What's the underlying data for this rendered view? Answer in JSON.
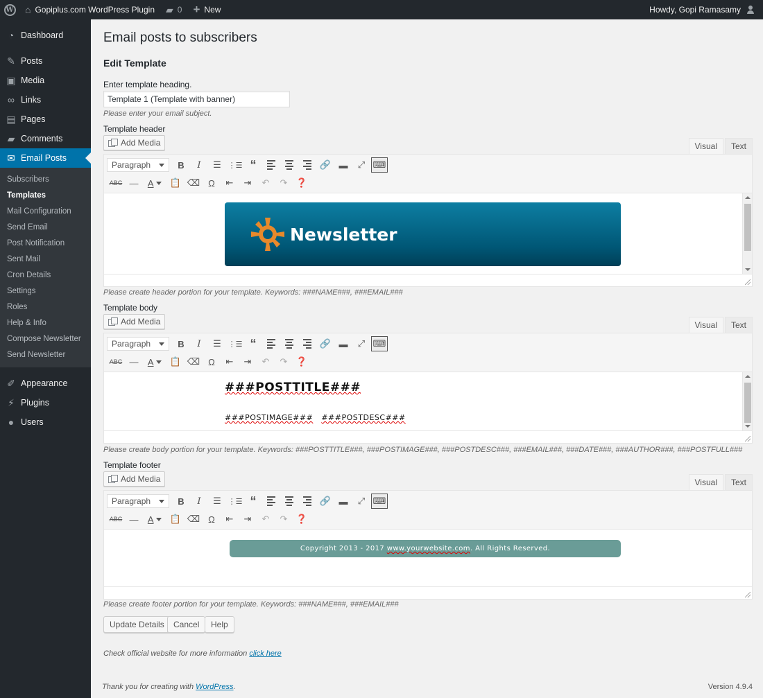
{
  "adminbar": {
    "site_name": "Gopiplus.com WordPress Plugin",
    "comments_count": "0",
    "new_label": "New",
    "greeting": "Howdy, Gopi Ramasamy"
  },
  "menu": {
    "dashboard": "Dashboard",
    "posts": "Posts",
    "media": "Media",
    "links": "Links",
    "pages": "Pages",
    "comments": "Comments",
    "email_posts": "Email Posts",
    "sub": [
      "Subscribers",
      "Templates",
      "Mail Configuration",
      "Send Email",
      "Post Notification",
      "Sent Mail",
      "Cron Details",
      "Settings",
      "Roles",
      "Help & Info",
      "Compose Newsletter",
      "Send Newsletter"
    ],
    "appearance": "Appearance",
    "plugins": "Plugins",
    "users": "Users"
  },
  "page": {
    "title": "Email posts to subscribers",
    "subtitle": "Edit Template",
    "heading_label": "Enter template heading.",
    "heading_value": "Template 1 (Template with banner)",
    "heading_desc": "Please enter your email subject.",
    "header_label": "Template header",
    "header_desc": "Please create header portion for your template. Keywords: ###NAME###, ###EMAIL###",
    "body_label": "Template body",
    "body_desc": "Please create body portion for your template. Keywords: ###POSTTITLE###, ###POSTIMAGE###, ###POSTDESC###, ###EMAIL###, ###DATE###, ###AUTHOR###, ###POSTFULL###",
    "footer_label": "Template footer",
    "footer_desc": "Please create footer portion for your template. Keywords: ###NAME###, ###EMAIL###"
  },
  "editor": {
    "add_media": "Add Media",
    "tab_visual": "Visual",
    "tab_text": "Text",
    "format": "Paragraph",
    "banner_text": "Newsletter",
    "post_title": "###POSTTITLE###",
    "post_image": "###POSTIMAGE###",
    "post_desc": "###POSTDESC###",
    "footer_text_pre": "Copyright 2013 - 2017 ",
    "footer_text_link": "www.yourwebsite.com",
    "footer_text_post": ". All Rights Reserved."
  },
  "buttons": {
    "update": "Update Details",
    "cancel": "Cancel",
    "help": "Help"
  },
  "info": {
    "text": "Check official website for more information ",
    "link": "click here"
  },
  "footer": {
    "thanks_pre": "Thank you for creating with ",
    "thanks_link": "WordPress",
    "thanks_post": ".",
    "version": "Version 4.9.4"
  },
  "colors": {
    "admin_dark": "#23282d",
    "accent": "#0073aa",
    "footer_bar": "#6a9c97"
  }
}
